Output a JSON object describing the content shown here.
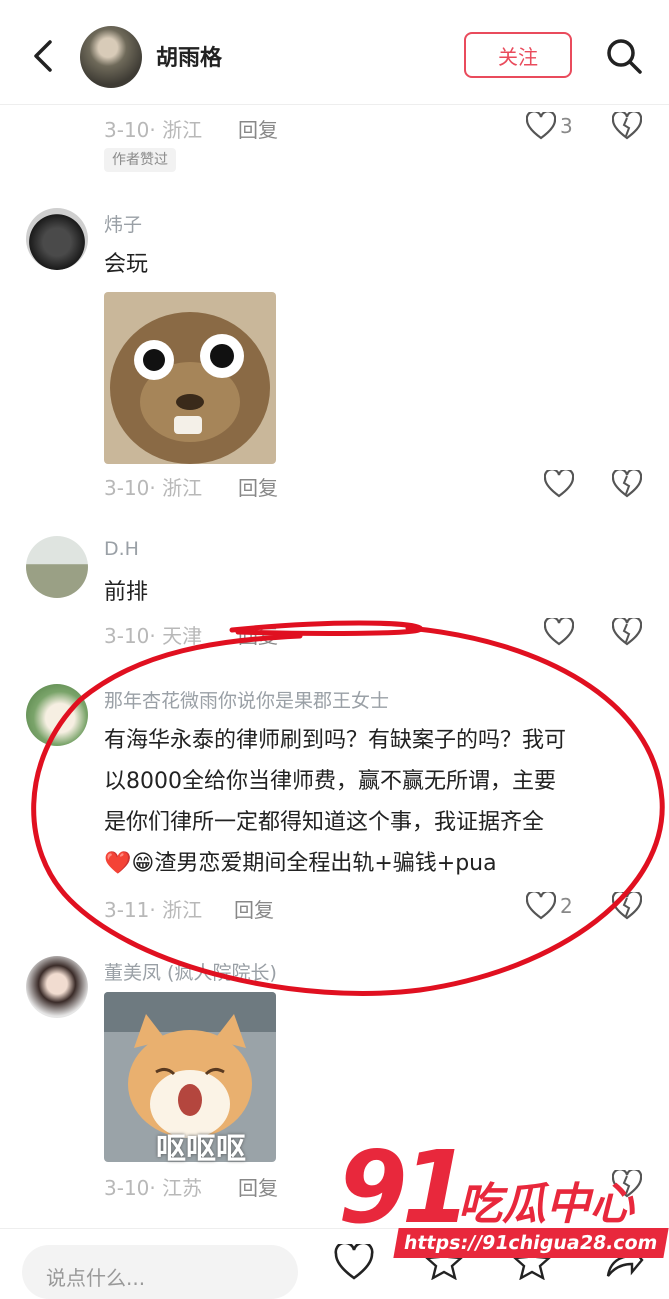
{
  "header": {
    "author_name": "胡雨格",
    "follow_label": "关注"
  },
  "comments": [
    {
      "date_location": "3-10· 浙江",
      "reply_label": "回复",
      "like_count": "3",
      "badge": "作者赞过"
    },
    {
      "username": "炜子",
      "text": "会玩",
      "date_location": "3-10· 浙江",
      "reply_label": "回复"
    },
    {
      "username": "D.H",
      "text": "前排",
      "date_location": "3-10· 天津",
      "reply_label": "回复"
    },
    {
      "username": "那年杏花微雨你说你是果郡王女士",
      "text_lines": [
        "有海华永泰的律师刷到吗？有缺案子的吗？我可",
        "以8000全给你当律师费，赢不赢无所谓，主要",
        "是你们律所一定都得知道这个事，我证据齐全",
        "渣男恋爱期间全程出轨+骗钱+pua"
      ],
      "emoji_heart": "❤️",
      "emoji_grin": "😁",
      "date_location": "3-11· 浙江",
      "reply_label": "回复",
      "like_count": "2"
    },
    {
      "username": "董美凤 (疯人院院长)",
      "sticker_text": "呕呕呕",
      "date_location": "3-10· 江苏",
      "reply_label": "回复"
    }
  ],
  "bottom": {
    "input_placeholder": "说点什么..."
  },
  "watermark": {
    "logo": "91",
    "name": "吃瓜中心",
    "url": "https://91chigua28.com"
  },
  "colors": {
    "accent": "#e94b5c",
    "annotation": "#e01020",
    "watermark": "#e8283c"
  }
}
